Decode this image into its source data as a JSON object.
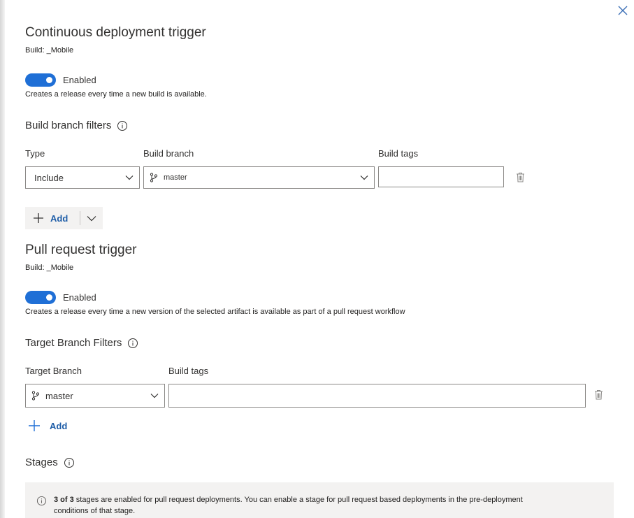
{
  "header": {
    "close_icon": "close-icon"
  },
  "continuous": {
    "title": "Continuous deployment trigger",
    "build_label": "Build: _Mobile",
    "toggle_label": "Enabled",
    "toggle_on": true,
    "description": "Creates a release every time a new build is available."
  },
  "build_branch_filters": {
    "title": "Build branch filters",
    "col_type": "Type",
    "col_branch": "Build branch",
    "col_tags": "Build tags",
    "type_value": "Include",
    "branch_value": "master",
    "tags_value": "",
    "add_label": "Add"
  },
  "pull_request": {
    "title": "Pull request trigger",
    "build_label": "Build: _Mobile",
    "toggle_label": "Enabled",
    "toggle_on": true,
    "description": "Creates a release every time a new version of the selected artifact is available as part of a pull request workflow"
  },
  "target_branch_filters": {
    "title": "Target Branch Filters",
    "col_branch": "Target Branch",
    "col_tags": "Build tags",
    "branch_value": "master",
    "tags_value": "",
    "add_label": "Add"
  },
  "stages": {
    "title": "Stages",
    "count_text": "3 of 3",
    "info_text_1": " stages are enabled for pull request deployments. You can enable a stage for pull request based deployments in the pre-deployment",
    "info_text_2": "conditions of that stage."
  },
  "colors": {
    "accent": "#1f6fd6",
    "link": "#1f5ea8"
  }
}
